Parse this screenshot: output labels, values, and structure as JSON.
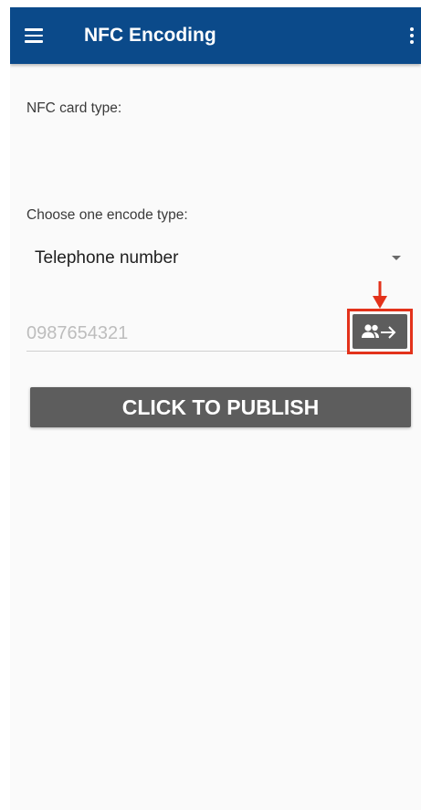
{
  "appbar": {
    "title": "NFC Encoding"
  },
  "form": {
    "card_type_label": "NFC card type:",
    "encode_type_label": "Choose one encode type:",
    "encode_type_selected": "Telephone number",
    "phone_placeholder": "0987654321",
    "publish_label": "CLICK TO PUBLISH"
  },
  "icons": {
    "menu": "hamburger-menu-icon",
    "overflow": "overflow-menu-icon",
    "contact_picker": "contacts-arrow-icon",
    "dropdown": "dropdown-caret-icon",
    "annotation_arrow": "down-arrow-icon"
  },
  "colors": {
    "appbar": "#0b4a8a",
    "button": "#5d5d5d",
    "highlight": "#e3321b",
    "background": "#fafafa"
  }
}
